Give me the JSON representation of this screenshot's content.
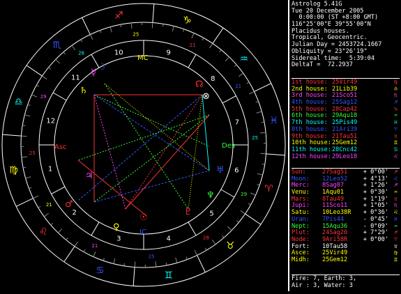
{
  "header": [
    "Astrolog 5.41G",
    "Tue 20 December 2005",
    "  0:00:00 (ST +8:00 GMT)",
    "116°25'00\"E 39°55'00\"N",
    "Placidus houses.",
    "Tropical, Geocentric.",
    "Julian Day = 2453724.1667",
    "Obliquity = 23°26'19\"",
    "Sidereal time:  5:39:04",
    "DeltaT =  72.2937"
  ],
  "houses": [
    {
      "label": "1st house:",
      "value": "25Vir49",
      "color": "#ff3333",
      "glyph": "♍"
    },
    {
      "label": "2nd house:",
      "value": "21Lib39",
      "color": "#ffff00",
      "glyph": "♎"
    },
    {
      "label": "3rd house:",
      "value": "21Sco51",
      "color": "#ff44ff",
      "glyph": "♏"
    },
    {
      "label": "4th house:",
      "value": "25Sag12",
      "color": "#3355ff",
      "glyph": "♐"
    },
    {
      "label": "5th house:",
      "value": "28Cap42",
      "color": "#ff3333",
      "glyph": "♑"
    },
    {
      "label": "6th house:",
      "value": "29Aqu18",
      "color": "#33ff33",
      "glyph": "♒"
    },
    {
      "label": "7th house:",
      "value": "25Pis49",
      "color": "#00ffff",
      "glyph": "♓"
    },
    {
      "label": "8th house:",
      "value": "21Ari39",
      "color": "#3355ff",
      "glyph": "♈"
    },
    {
      "label": "9th house:",
      "value": "21Tau51",
      "color": "#ff3333",
      "glyph": "♉"
    },
    {
      "label": "10th house:",
      "value": "25Gem12",
      "color": "#ffff00",
      "glyph": "♊"
    },
    {
      "label": "11th house:",
      "value": "28Cnc42",
      "color": "#00ffff",
      "glyph": "♋"
    },
    {
      "label": "12th house:",
      "value": "29Leo18",
      "color": "#ff44ff",
      "glyph": "♌"
    }
  ],
  "planets": [
    {
      "name": "Sun:",
      "pos": "27Sag51",
      "aspect": "+ 0°00'",
      "color": "#ff3333",
      "glyph": "♐"
    },
    {
      "name": "Moon:",
      "pos": "12Leo52",
      "aspect": "+ 4°13'",
      "color": "#3355ff",
      "glyph": "♌"
    },
    {
      "name": "Merc:",
      "pos": "8Sag07",
      "aspect": "+ 1°26'",
      "color": "#ff44ff",
      "glyph": "♐"
    },
    {
      "name": "Venu:",
      "pos": "1Aqu01",
      "aspect": "+ 0°30'",
      "color": "#ffff00",
      "glyph": "♒"
    },
    {
      "name": "Mars:",
      "pos": "8Tau49",
      "aspect": "+ 1°19'",
      "color": "#ff3333",
      "glyph": "♉"
    },
    {
      "name": "Jupi:",
      "pos": "11Sco11",
      "aspect": "+ 1°05'",
      "color": "#ff44ff",
      "glyph": "♏"
    },
    {
      "name": "Satu:",
      "pos": "10Leo38R",
      "aspect": "+ 0°36'",
      "color": "#ffff00",
      "glyph": "♌"
    },
    {
      "name": "Uran:",
      "pos": "7Pis44",
      "aspect": "- 0°45'",
      "color": "#3355ff",
      "glyph": "♓"
    },
    {
      "name": "Nept:",
      "pos": "15Aqu36",
      "aspect": "- 0°09'",
      "color": "#33ff33",
      "glyph": "♒"
    },
    {
      "name": "Plut:",
      "pos": "24Sag26",
      "aspect": "+ 7°29'",
      "color": "#ff3333",
      "glyph": "♐"
    },
    {
      "name": "Node:",
      "pos": "9Ari58R",
      "aspect": "+ 0°00'",
      "color": "#ff3333",
      "glyph": "♈"
    },
    {
      "name": "Fort:",
      "pos": "10Tau58",
      "aspect": "",
      "color": "#ffffff",
      "glyph": "♉"
    },
    {
      "name": "Asce:",
      "pos": "25Vir49",
      "aspect": "",
      "color": "#ffff00",
      "glyph": "♍"
    },
    {
      "name": "Midh:",
      "pos": "25Gem12",
      "aspect": "",
      "color": "#ffff00",
      "glyph": "♊"
    }
  ],
  "elements": {
    "line1": "Fire: 7, Earth: 3,",
    "line2": "Air : 3, Water: 3"
  },
  "wheel": {
    "zodiac_glyphs": [
      "♈",
      "♉",
      "♊",
      "♋",
      "♌",
      "♍",
      "♎",
      "♏",
      "♐",
      "♑",
      "♒",
      "♓"
    ],
    "zodiac_colors": [
      "#ff3333",
      "#ffff00",
      "#00ffff",
      "#3355ff",
      "#ff3333",
      "#ffff00",
      "#00ffff",
      "#3355ff",
      "#ff3333",
      "#ffff00",
      "#00ffff",
      "#3355ff"
    ],
    "house_numbers": [
      "1",
      "2",
      "3",
      "4",
      "5",
      "6",
      "7",
      "8",
      "9",
      "10",
      "11",
      "12"
    ],
    "asc_label": "Asc",
    "desc_label": "Des",
    "mc_label": "MC",
    "ic_label": "IC",
    "degree_labels": [
      "25",
      "21",
      "21",
      "25",
      "28",
      "29",
      "25",
      "21",
      "21",
      "25",
      "28",
      "29"
    ]
  }
}
